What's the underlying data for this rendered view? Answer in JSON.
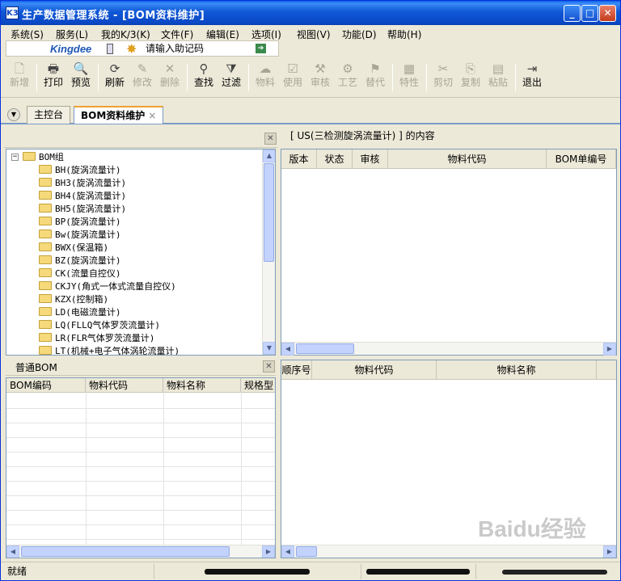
{
  "window": {
    "app_icon": "K3",
    "title": "生产数据管理系统 - [BOM资料维护]",
    "minimize_icon": "minimize-icon",
    "maximize_icon": "maximize-icon",
    "close_icon": "close-icon"
  },
  "menu": [
    "系统(S)",
    "服务(L)",
    "我的K/3(K)",
    "文件(F)",
    "编辑(E)",
    "选项(I)",
    "视图(V)",
    "功能(D)",
    "帮助(H)"
  ],
  "logobar": {
    "brand": "Kingdee",
    "helper_placeholder": "请输入助记码"
  },
  "toolbar": [
    {
      "label": "新增",
      "icon": "new-icon",
      "glyph": "🗋",
      "enabled": false
    },
    {
      "label": "打印",
      "icon": "print-icon",
      "glyph": "🖶",
      "enabled": true
    },
    {
      "label": "预览",
      "icon": "preview-icon",
      "glyph": "🔍",
      "enabled": true
    },
    {
      "label": "刷新",
      "icon": "refresh-icon",
      "glyph": "⟳",
      "enabled": true
    },
    {
      "label": "修改",
      "icon": "edit-icon",
      "glyph": "✎",
      "enabled": false
    },
    {
      "label": "删除",
      "icon": "delete-icon",
      "glyph": "✕",
      "enabled": false
    },
    {
      "label": "查找",
      "icon": "find-icon",
      "glyph": "⚲",
      "enabled": true
    },
    {
      "label": "过滤",
      "icon": "filter-icon",
      "glyph": "⧩",
      "enabled": true
    },
    {
      "label": "物料",
      "icon": "material-icon",
      "glyph": "☁",
      "enabled": false
    },
    {
      "label": "使用",
      "icon": "use-icon",
      "glyph": "☑",
      "enabled": false
    },
    {
      "label": "审核",
      "icon": "audit-icon",
      "glyph": "⚒",
      "enabled": false
    },
    {
      "label": "工艺",
      "icon": "process-icon",
      "glyph": "⚙",
      "enabled": false
    },
    {
      "label": "替代",
      "icon": "substitute-icon",
      "glyph": "⚑",
      "enabled": false
    },
    {
      "label": "特性",
      "icon": "feature-icon",
      "glyph": "▦",
      "enabled": false
    },
    {
      "label": "剪切",
      "icon": "cut-icon",
      "glyph": "✂",
      "enabled": false
    },
    {
      "label": "复制",
      "icon": "copy-icon",
      "glyph": "⎘",
      "enabled": false
    },
    {
      "label": "粘贴",
      "icon": "paste-icon",
      "glyph": "▤",
      "enabled": false
    },
    {
      "label": "退出",
      "icon": "exit-icon",
      "glyph": "⇥",
      "enabled": true
    }
  ],
  "tabs": [
    {
      "label": "主控台",
      "active": false
    },
    {
      "label": "BOM资料维护",
      "active": true,
      "close": "×"
    }
  ],
  "tree": {
    "root": "BOM组",
    "expander": "−",
    "items": [
      "BH(旋涡流量计)",
      "BH3(旋涡流量计)",
      "BH4(旋涡流量计)",
      "BH5(旋涡流量计)",
      "BP(旋涡流量计)",
      "Bw(旋涡流量计)",
      "BWX(保温箱)",
      "BZ(旋涡流量计)",
      "CK(流量自控仪)",
      "CKJY(角式一体式流量自控仪)",
      "KZX(控制箱)",
      "LD(电磁流量计)",
      "LQ(FLLQ气体罗茨流量计)",
      "LR(FLR气体罗茨流量计)",
      "LT(机械+电子气体涡轮流量计)"
    ]
  },
  "right_top": {
    "caption": "[ US(三检测旋涡流量计) ] 的内容",
    "columns": [
      "版本",
      "状态",
      "审核",
      "物料代码",
      "BOM单编号"
    ]
  },
  "bottom_left": {
    "tab": "普通BOM",
    "columns": [
      "BOM编码",
      "物料代码",
      "物料名称",
      "规格型"
    ]
  },
  "bottom_right": {
    "columns": [
      "顺序号",
      "物料代码",
      "物料名称"
    ]
  },
  "statusbar": {
    "ready": "就绪"
  },
  "watermark": "Baidu经验"
}
